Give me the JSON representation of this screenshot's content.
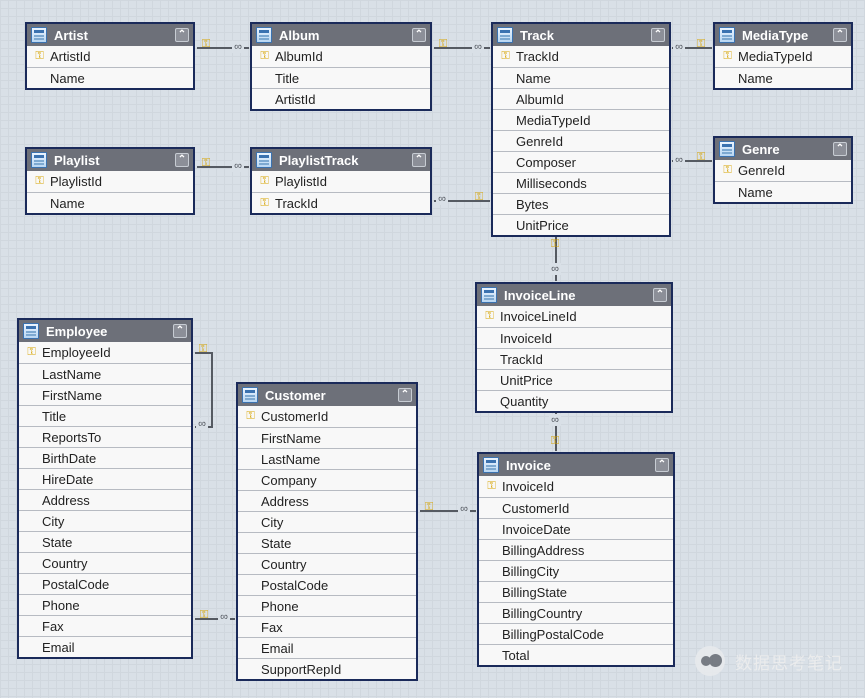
{
  "tables": {
    "artist": {
      "title": "Artist",
      "pk": [
        "ArtistId"
      ],
      "cols": [
        "ArtistId",
        "Name"
      ]
    },
    "album": {
      "title": "Album",
      "pk": [
        "AlbumId"
      ],
      "cols": [
        "AlbumId",
        "Title",
        "ArtistId"
      ]
    },
    "track": {
      "title": "Track",
      "pk": [
        "TrackId"
      ],
      "cols": [
        "TrackId",
        "Name",
        "AlbumId",
        "MediaTypeId",
        "GenreId",
        "Composer",
        "Milliseconds",
        "Bytes",
        "UnitPrice"
      ]
    },
    "mediatype": {
      "title": "MediaType",
      "pk": [
        "MediaTypeId"
      ],
      "cols": [
        "MediaTypeId",
        "Name"
      ]
    },
    "genre": {
      "title": "Genre",
      "pk": [
        "GenreId"
      ],
      "cols": [
        "GenreId",
        "Name"
      ]
    },
    "playlist": {
      "title": "Playlist",
      "pk": [
        "PlaylistId"
      ],
      "cols": [
        "PlaylistId",
        "Name"
      ]
    },
    "playlisttrack": {
      "title": "PlaylistTrack",
      "pk": [
        "PlaylistId",
        "TrackId"
      ],
      "cols": [
        "PlaylistId",
        "TrackId"
      ]
    },
    "invoiceline": {
      "title": "InvoiceLine",
      "pk": [
        "InvoiceLineId"
      ],
      "cols": [
        "InvoiceLineId",
        "InvoiceId",
        "TrackId",
        "UnitPrice",
        "Quantity"
      ]
    },
    "invoice": {
      "title": "Invoice",
      "pk": [
        "InvoiceId"
      ],
      "cols": [
        "InvoiceId",
        "CustomerId",
        "InvoiceDate",
        "BillingAddress",
        "BillingCity",
        "BillingState",
        "BillingCountry",
        "BillingPostalCode",
        "Total"
      ]
    },
    "customer": {
      "title": "Customer",
      "pk": [
        "CustomerId"
      ],
      "cols": [
        "CustomerId",
        "FirstName",
        "LastName",
        "Company",
        "Address",
        "City",
        "State",
        "Country",
        "PostalCode",
        "Phone",
        "Fax",
        "Email",
        "SupportRepId"
      ]
    },
    "employee": {
      "title": "Employee",
      "pk": [
        "EmployeeId"
      ],
      "cols": [
        "EmployeeId",
        "LastName",
        "FirstName",
        "Title",
        "ReportsTo",
        "BirthDate",
        "HireDate",
        "Address",
        "City",
        "State",
        "Country",
        "PostalCode",
        "Phone",
        "Fax",
        "Email"
      ]
    }
  },
  "relationships": [
    {
      "from": "album.ArtistId",
      "to": "artist.ArtistId"
    },
    {
      "from": "track.AlbumId",
      "to": "album.AlbumId"
    },
    {
      "from": "track.MediaTypeId",
      "to": "mediatype.MediaTypeId"
    },
    {
      "from": "track.GenreId",
      "to": "genre.GenreId"
    },
    {
      "from": "playlisttrack.PlaylistId",
      "to": "playlist.PlaylistId"
    },
    {
      "from": "playlisttrack.TrackId",
      "to": "track.TrackId"
    },
    {
      "from": "invoiceline.TrackId",
      "to": "track.TrackId"
    },
    {
      "from": "invoiceline.InvoiceId",
      "to": "invoice.InvoiceId"
    },
    {
      "from": "invoice.CustomerId",
      "to": "customer.CustomerId"
    },
    {
      "from": "customer.SupportRepId",
      "to": "employee.EmployeeId"
    },
    {
      "from": "employee.ReportsTo",
      "to": "employee.EmployeeId"
    }
  ],
  "watermark": "数据思考笔记"
}
